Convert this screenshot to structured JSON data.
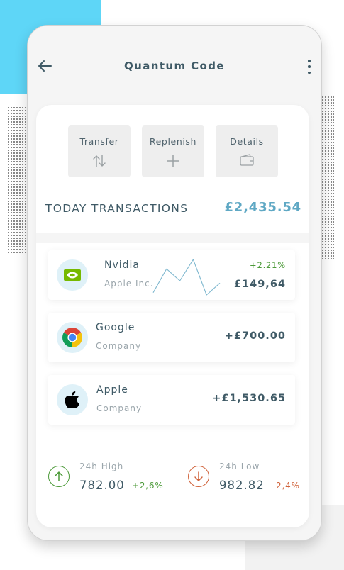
{
  "header": {
    "title": "Quantum Code"
  },
  "actions": [
    {
      "label": "Transfer",
      "icon": "swap-vertical-icon"
    },
    {
      "label": "Replenish",
      "icon": "plus-icon"
    },
    {
      "label": "Details",
      "icon": "wallet-icon"
    }
  ],
  "summary": {
    "label": "TODAY TRANSACTIONS",
    "amount": "£2,435.54"
  },
  "transactions": [
    {
      "name": "Nvidia",
      "subtitle": "Apple Inc.",
      "change": "+2.21%",
      "amount": "£149,64",
      "icon": "nvidia-logo-icon",
      "sparkline": [
        62,
        82,
        72,
        90,
        60,
        70
      ]
    },
    {
      "name": "Google",
      "subtitle": "Company",
      "amount": "+£700.00",
      "icon": "chrome-logo-icon"
    },
    {
      "name": "Apple",
      "subtitle": "Company",
      "amount": "+£1,530.65",
      "icon": "apple-logo-icon"
    }
  ],
  "stats": {
    "high": {
      "label": "24h High",
      "value": "782.00",
      "change": "+2,6%",
      "icon": "arrow-up-circle-icon"
    },
    "low": {
      "label": "24h Low",
      "value": "982.82",
      "change": "-2,4%",
      "icon": "arrow-down-circle-icon"
    }
  },
  "colors": {
    "accent": "#5fa8c4",
    "positive": "#4c9a39",
    "negative": "#d0623a",
    "text": "#3f5a66",
    "muted": "#9aa5ab"
  }
}
